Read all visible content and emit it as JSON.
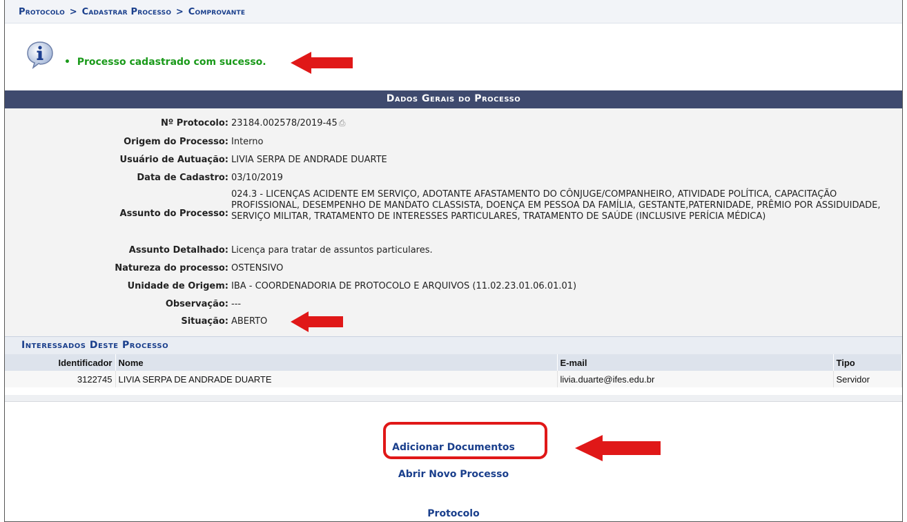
{
  "breadcrumb": {
    "items": [
      "Protocolo",
      "Cadastrar Processo",
      "Comprovante"
    ],
    "separator": ">"
  },
  "message": {
    "bullet": "•",
    "text": "Processo cadastrado com sucesso.",
    "color": "#1a9a1a"
  },
  "section_title": "Dados Gerais do Processo",
  "details": {
    "protocolo_label": "Nº Protocolo:",
    "protocolo_value": "23184.002578/2019-45",
    "origem_label": "Origem do Processo:",
    "origem_value": "Interno",
    "usuario_label": "Usuário de Autuação:",
    "usuario_value": "LIVIA SERPA DE ANDRADE DUARTE",
    "data_label": "Data de Cadastro:",
    "data_value": "03/10/2019",
    "assunto_label": "Assunto do Processo:",
    "assunto_value": "024.3 - LICENÇAS ACIDENTE EM SERVIÇO, ADOTANTE AFASTAMENTO DO CÔNJUGE/COMPANHEIRO, ATIVIDADE POLÍTICA, CAPACITAÇÃO PROFISSIONAL, DESEMPENHO DE MANDATO CLASSISTA, DOENÇA EM PESSOA DA FAMÍLIA, GESTANTE,PATERNIDADE, PRÊMIO POR ASSIDUIDADE, SERVIÇO MILITAR, TRATAMENTO DE INTERESSES PARTICULARES, TRATAMENTO DE SAÚDE (INCLUSIVE PERÍCIA MÉDICA)",
    "assunto_det_label": "Assunto Detalhado:",
    "assunto_det_value": "Licença para tratar de assuntos particulares.",
    "natureza_label": "Natureza do processo:",
    "natureza_value": "OSTENSIVO",
    "unidade_label": "Unidade de Origem:",
    "unidade_value": "IBA - COORDENADORIA DE PROTOCOLO E ARQUIVOS (11.02.23.01.06.01.01)",
    "obs_label": "Observação:",
    "obs_value": "---",
    "situacao_label": "Situação:",
    "situacao_value": "ABERTO"
  },
  "interessados": {
    "title": "Interessados Deste Processo",
    "columns": [
      "Identificador",
      "Nome",
      "E-mail",
      "Tipo"
    ],
    "rows": [
      [
        "3122745",
        "LIVIA SERPA DE ANDRADE DUARTE",
        "livia.duarte@ifes.edu.br",
        "Servidor"
      ]
    ]
  },
  "links": {
    "adicionar": "Adicionar Documentos",
    "abrir": "Abrir Novo Processo",
    "protocolo": "Protocolo"
  },
  "colors": {
    "annotation_red": "#e01818",
    "header_bar": "#3f4a6e",
    "link_blue": "#1a3f8c"
  }
}
